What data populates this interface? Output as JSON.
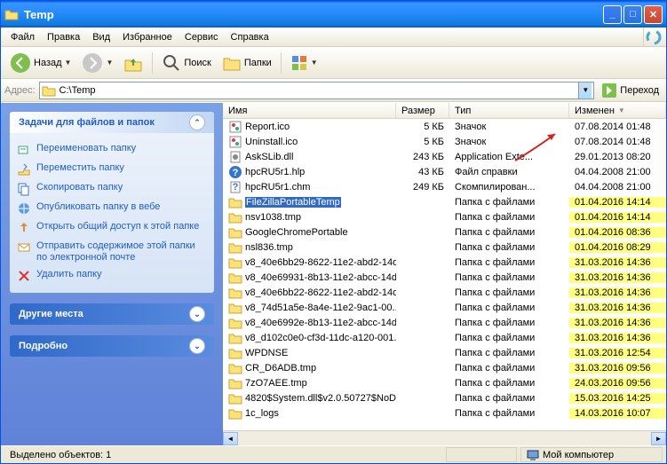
{
  "title": "Temp",
  "menu": [
    "Файл",
    "Правка",
    "Вид",
    "Избранное",
    "Сервис",
    "Справка"
  ],
  "toolbar": {
    "back": "Назад",
    "search": "Поиск",
    "folders": "Папки"
  },
  "address": {
    "label": "Адрес:",
    "value": "C:\\Temp",
    "go": "Переход"
  },
  "sidepanel": {
    "tasks_title": "Задачи для файлов и папок",
    "tasks": [
      {
        "icon": "rename",
        "label": "Переименовать папку"
      },
      {
        "icon": "move",
        "label": "Переместить папку"
      },
      {
        "icon": "copy",
        "label": "Скопировать папку"
      },
      {
        "icon": "publish",
        "label": "Опубликовать папку в вебе"
      },
      {
        "icon": "share",
        "label": "Открыть общий доступ к этой папке"
      },
      {
        "icon": "email",
        "label": "Отправить содержимое этой папки по электронной почте"
      },
      {
        "icon": "delete",
        "label": "Удалить папку"
      }
    ],
    "other_title": "Другие места",
    "details_title": "Подробно"
  },
  "columns": [
    {
      "key": "name",
      "label": "Имя"
    },
    {
      "key": "size",
      "label": "Размер"
    },
    {
      "key": "type",
      "label": "Тип"
    },
    {
      "key": "date",
      "label": "Изменен",
      "sorted": true
    }
  ],
  "rows": [
    {
      "icon": "ico",
      "name": "Report.ico",
      "size": "5 КБ",
      "type": "Значок",
      "date": "07.08.2014 01:48",
      "hl": false,
      "sel": false
    },
    {
      "icon": "ico",
      "name": "Uninstall.ico",
      "size": "5 КБ",
      "type": "Значок",
      "date": "07.08.2014 01:48",
      "hl": false,
      "sel": false
    },
    {
      "icon": "dll",
      "name": "AskSLib.dll",
      "size": "243 КБ",
      "type": "Application Exte...",
      "date": "29.01.2013 08:20",
      "hl": false,
      "sel": false
    },
    {
      "icon": "hlp",
      "name": "hpcRU5r1.hlp",
      "size": "43 КБ",
      "type": "Файл справки",
      "date": "04.04.2008 21:00",
      "hl": false,
      "sel": false
    },
    {
      "icon": "chm",
      "name": "hpcRU5r1.chm",
      "size": "249 КБ",
      "type": "Скомпилирован...",
      "date": "04.04.2008 21:00",
      "hl": false,
      "sel": false
    },
    {
      "icon": "folder",
      "name": "FileZillaPortableTemp",
      "size": "",
      "type": "Папка с файлами",
      "date": "01.04.2016 14:14",
      "hl": true,
      "sel": true
    },
    {
      "icon": "folder",
      "name": "nsv1038.tmp",
      "size": "",
      "type": "Папка с файлами",
      "date": "01.04.2016 14:14",
      "hl": true,
      "sel": false
    },
    {
      "icon": "folder",
      "name": "GoogleChromePortable",
      "size": "",
      "type": "Папка с файлами",
      "date": "01.04.2016 08:36",
      "hl": true,
      "sel": false
    },
    {
      "icon": "folder",
      "name": "nsl836.tmp",
      "size": "",
      "type": "Папка с файлами",
      "date": "01.04.2016 08:29",
      "hl": true,
      "sel": false
    },
    {
      "icon": "folder",
      "name": "v8_40e6bb29-8622-11e2-abd2-14d...",
      "size": "",
      "type": "Папка с файлами",
      "date": "31.03.2016 14:36",
      "hl": true,
      "sel": false
    },
    {
      "icon": "folder",
      "name": "v8_40e69931-8b13-11e2-abcc-14d...",
      "size": "",
      "type": "Папка с файлами",
      "date": "31.03.2016 14:36",
      "hl": true,
      "sel": false
    },
    {
      "icon": "folder",
      "name": "v8_40e6bb22-8622-11e2-abd2-14d...",
      "size": "",
      "type": "Папка с файлами",
      "date": "31.03.2016 14:36",
      "hl": true,
      "sel": false
    },
    {
      "icon": "folder",
      "name": "v8_74d51a5e-8a4e-11e2-9ac1-00...",
      "size": "",
      "type": "Папка с файлами",
      "date": "31.03.2016 14:36",
      "hl": true,
      "sel": false
    },
    {
      "icon": "folder",
      "name": "v8_40e6992e-8b13-11e2-abcc-14d...",
      "size": "",
      "type": "Папка с файлами",
      "date": "31.03.2016 14:36",
      "hl": true,
      "sel": false
    },
    {
      "icon": "folder",
      "name": "v8_d102c0e0-cf3d-11dc-a120-001...",
      "size": "",
      "type": "Папка с файлами",
      "date": "31.03.2016 14:36",
      "hl": true,
      "sel": false
    },
    {
      "icon": "folder",
      "name": "WPDNSE",
      "size": "",
      "type": "Папка с файлами",
      "date": "31.03.2016 12:54",
      "hl": true,
      "sel": false
    },
    {
      "icon": "folder",
      "name": "CR_D6ADB.tmp",
      "size": "",
      "type": "Папка с файлами",
      "date": "31.03.2016 09:56",
      "hl": true,
      "sel": false
    },
    {
      "icon": "folder",
      "name": "7zO7AEE.tmp",
      "size": "",
      "type": "Папка с файлами",
      "date": "24.03.2016 09:56",
      "hl": true,
      "sel": false
    },
    {
      "icon": "folder",
      "name": "4820$System.dll$v2.0.50727$NoD...",
      "size": "",
      "type": "Папка с файлами",
      "date": "15.03.2016 14:25",
      "hl": true,
      "sel": false
    },
    {
      "icon": "folder",
      "name": "1c_logs",
      "size": "",
      "type": "Папка с файлами",
      "date": "14.03.2016 10:07",
      "hl": true,
      "sel": false
    }
  ],
  "status": {
    "selected": "Выделено объектов: 1",
    "computer": "Мой компьютер"
  }
}
